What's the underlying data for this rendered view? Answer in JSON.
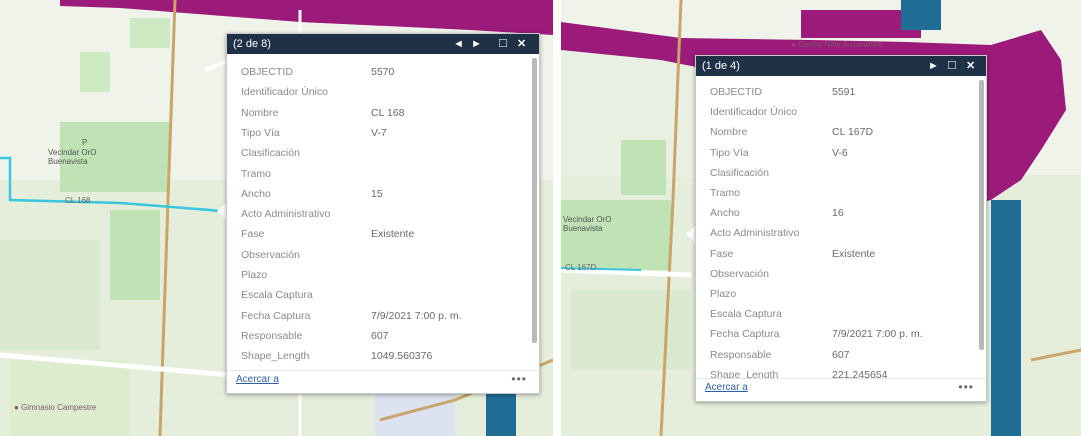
{
  "left": {
    "map_labels": {
      "school": "Vecindar OrO\nBuenavista",
      "pf": "P",
      "street": "CL 168",
      "gym": "Gimnasio Campestre"
    },
    "popup": {
      "title": "(2 de 8)",
      "fields": [
        {
          "label": "OBJECTID",
          "value": "5570"
        },
        {
          "label": "Identificador Único",
          "value": ""
        },
        {
          "label": "Nombre",
          "value": "CL 168"
        },
        {
          "label": "Tipo Vía",
          "value": "V-7"
        },
        {
          "label": "Clasificación",
          "value": ""
        },
        {
          "label": "Tramo",
          "value": ""
        },
        {
          "label": "Ancho",
          "value": "15"
        },
        {
          "label": "Acto Administrativo",
          "value": ""
        },
        {
          "label": "Fase",
          "value": "Existente"
        },
        {
          "label": "Observación",
          "value": ""
        },
        {
          "label": "Plazo",
          "value": ""
        },
        {
          "label": "Escala Captura",
          "value": ""
        },
        {
          "label": "Fecha Captura",
          "value": "7/9/2021 7:00 p. m."
        },
        {
          "label": "Responsable",
          "value": "607"
        },
        {
          "label": "Shape_Length",
          "value": "1049.560376"
        }
      ],
      "zoom_label": "Acercar a",
      "more_label": "•••"
    }
  },
  "right": {
    "map_labels": {
      "center": "Centro Nela Auxiliadora",
      "school": "Vecindar OrO\nBuenavista",
      "street": "CL 167D"
    },
    "popup": {
      "title": "(1 de 4)",
      "fields": [
        {
          "label": "OBJECTID",
          "value": "5591"
        },
        {
          "label": "Identificador Único",
          "value": ""
        },
        {
          "label": "Nombre",
          "value": "CL 167D"
        },
        {
          "label": "Tipo Vía",
          "value": "V-6"
        },
        {
          "label": "Clasificación",
          "value": ""
        },
        {
          "label": "Tramo",
          "value": ""
        },
        {
          "label": "Ancho",
          "value": "16"
        },
        {
          "label": "Acto Administrativo",
          "value": ""
        },
        {
          "label": "Fase",
          "value": "Existente"
        },
        {
          "label": "Observación",
          "value": ""
        },
        {
          "label": "Plazo",
          "value": ""
        },
        {
          "label": "Escala Captura",
          "value": ""
        },
        {
          "label": "Fecha Captura",
          "value": "7/9/2021 7:00 p. m."
        },
        {
          "label": "Responsable",
          "value": "607"
        },
        {
          "label": "Shape_Length",
          "value": "221.245654"
        }
      ],
      "zoom_label": "Acercar a",
      "more_label": "•••"
    }
  },
  "icons": {
    "prev": "◄",
    "next": "►",
    "maximize": "□",
    "close": "✕"
  },
  "colors": {
    "header": "#1f3146",
    "magenta_road": "#9b1a7a",
    "blue_water": "#1f6c95",
    "green_park": "#bfe3b4",
    "highlight": "#39c6e0"
  }
}
